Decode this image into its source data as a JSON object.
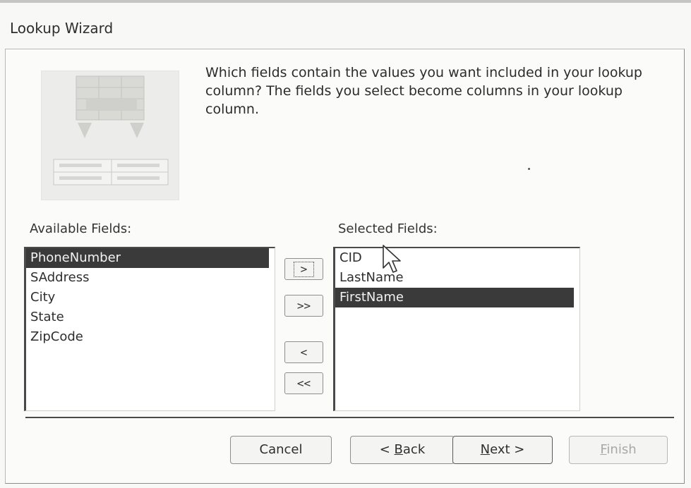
{
  "window": {
    "title": "Lookup Wizard"
  },
  "prompt": "Which fields contain the values you want included in your lookup column? The fields you select become columns in your lookup column.",
  "available": {
    "label": "Available Fields:",
    "items": [
      "PhoneNumber",
      "SAddress",
      "City",
      "State",
      "ZipCode"
    ],
    "selected_item": "PhoneNumber"
  },
  "selected": {
    "label": "Selected Fields:",
    "items": [
      "CID",
      "LastName",
      "FirstName"
    ],
    "selected_item": "FirstName"
  },
  "move_buttons": {
    "add": ">",
    "add_all": ">>",
    "remove": "<",
    "remove_all": "<<"
  },
  "dialog_buttons": {
    "cancel": "Cancel",
    "back_prefix": "< ",
    "back_mnemonic": "B",
    "back_rest": "ack",
    "next_mnemonic": "N",
    "next_rest": "ext >",
    "finish_mnemonic": "F",
    "finish_rest": "inish"
  },
  "colors": {
    "selection": "#3a3a3a",
    "frame_border": "#b9b9b6"
  }
}
